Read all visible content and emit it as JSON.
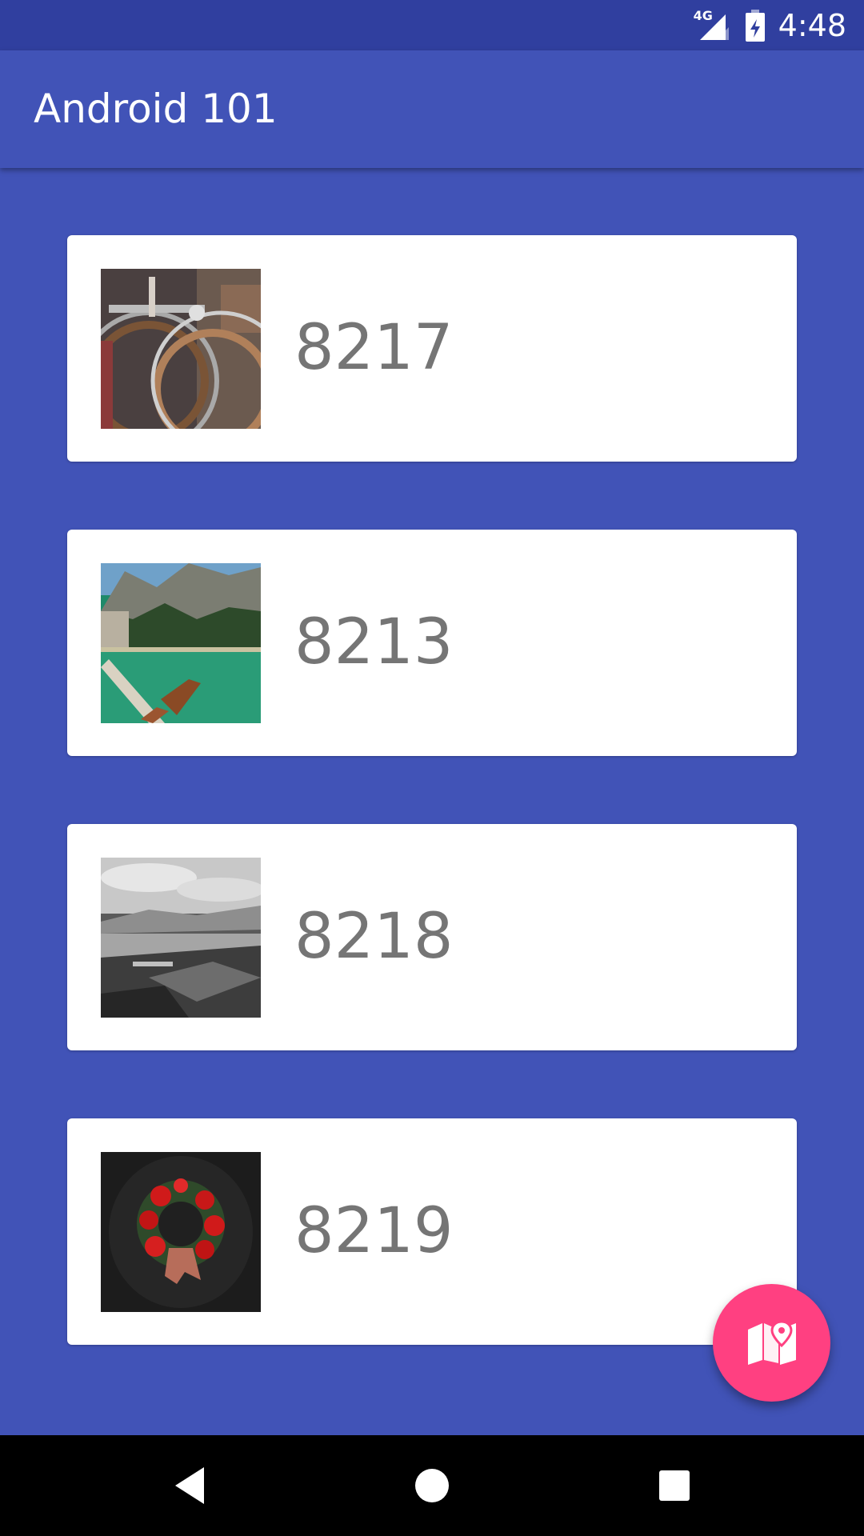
{
  "status_bar": {
    "network_label": "4G",
    "time": "4:48",
    "icons": [
      "network-signal-icon",
      "battery-charging-icon"
    ]
  },
  "app_bar": {
    "title": "Android 101"
  },
  "list": {
    "items": [
      {
        "number": "8217",
        "thumbnail": "bicycles-photo"
      },
      {
        "number": "8213",
        "thumbnail": "mountain-lake-boats-photo"
      },
      {
        "number": "8218",
        "thumbnail": "black-white-landscape-photo"
      },
      {
        "number": "8219",
        "thumbnail": "christmas-wreath-photo"
      }
    ]
  },
  "fab": {
    "icon": "map-marker-icon"
  },
  "nav_bar": {
    "icons": [
      "back-icon",
      "home-icon",
      "recents-icon"
    ]
  },
  "colors": {
    "primary": "#4153B7",
    "primary_dark": "#303F9F",
    "accent": "#FF4081",
    "card_text": "#757575"
  }
}
